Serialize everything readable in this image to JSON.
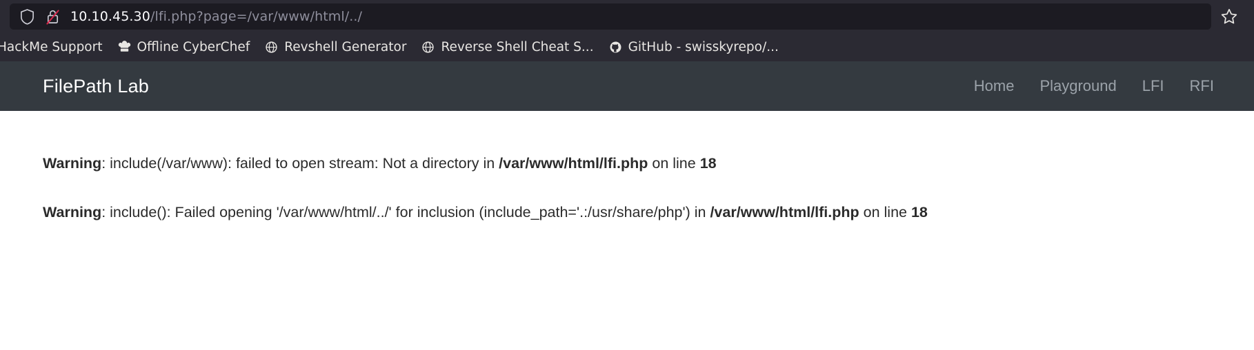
{
  "browser": {
    "icons": {
      "shield": "shield-icon",
      "lock_insecure": "broken-lock-icon",
      "bookmark_star": "star-icon"
    },
    "url": {
      "host": "10.10.45.30",
      "path": "/lfi.php?page=/var/www/html/../",
      "full": "10.10.45.30/lfi.php?page=/var/www/html/../"
    },
    "bookmarks": [
      {
        "label": "HackMe Support",
        "icon": "none"
      },
      {
        "label": "Offline CyberChef",
        "icon": "chef-hat-icon"
      },
      {
        "label": "Revshell Generator",
        "icon": "globe-icon"
      },
      {
        "label": "Reverse Shell Cheat S...",
        "icon": "globe-icon"
      },
      {
        "label": "GitHub - swisskyrepo/...",
        "icon": "github-icon"
      }
    ]
  },
  "page": {
    "navbar": {
      "brand": "FilePath Lab",
      "links": [
        {
          "label": "Home"
        },
        {
          "label": "Playground"
        },
        {
          "label": "LFI"
        },
        {
          "label": "RFI"
        }
      ]
    },
    "warnings": [
      {
        "prefix": "Warning",
        "sep": ": ",
        "body": "include(/var/www): failed to open stream: Not a directory in ",
        "file": "/var/www/html/lfi.php",
        "mid": " on line ",
        "line": "18"
      },
      {
        "prefix": "Warning",
        "sep": ": ",
        "body": "include(): Failed opening '/var/www/html/../' for inclusion (include_path='.:/usr/share/php') in ",
        "file": "/var/www/html/lfi.php",
        "mid": " on line ",
        "line": "18"
      }
    ]
  },
  "colors": {
    "chrome_bg": "#2b2a33",
    "urlbar_bg": "#1c1b22",
    "navbar_bg": "#343a40",
    "page_bg": "#ffffff",
    "nav_link": "#9ba2a9",
    "insecure_red": "#d7264a"
  }
}
